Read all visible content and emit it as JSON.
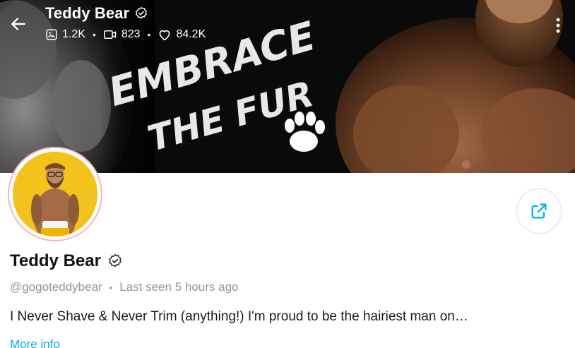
{
  "header": {
    "title": "Teddy Bear",
    "stats": {
      "photos": "1.2K",
      "videos": "823",
      "likes": "84.2K"
    },
    "banner_text_line1": "EMBRACE",
    "banner_text_line2": "THE FUR"
  },
  "profile": {
    "name": "Teddy Bear",
    "handle": "@gogoteddybear",
    "last_seen": "Last seen 5 hours ago",
    "bio": "I Never Shave & Never Trim (anything!) I'm proud to be the hairiest man on…",
    "more_info": "More info"
  },
  "colors": {
    "accent": "#00aff0",
    "muted": "#8a96a3",
    "avatar_ring": "#f5b8b8"
  },
  "icons": {
    "back": "arrow-left-icon",
    "verified": "verified-badge-icon",
    "photos": "image-icon",
    "videos": "video-icon",
    "likes": "heart-icon",
    "more": "more-vertical-icon",
    "share": "share-icon"
  }
}
